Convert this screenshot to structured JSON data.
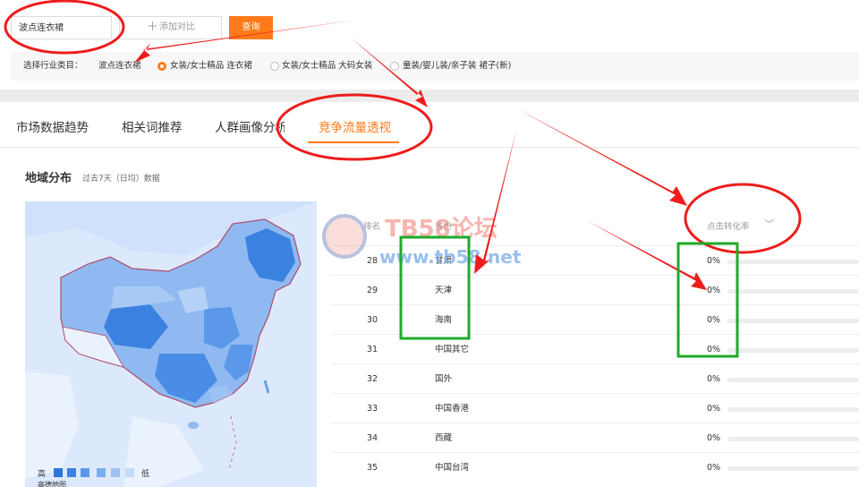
{
  "search": {
    "keyword": "波点连衣裙",
    "compare_label": "添加对比",
    "query_button": "查询"
  },
  "category": {
    "label": "选择行业类目：",
    "keyword": "波点连衣裙",
    "options": [
      {
        "label": "女装/女士精品 连衣裙",
        "selected": true
      },
      {
        "label": "女装/女士精品 大码女装",
        "selected": false
      },
      {
        "label": "童装/婴儿装/亲子装 裙子(新)",
        "selected": false
      }
    ]
  },
  "tabs": [
    {
      "label": "市场数据趋势",
      "active": false
    },
    {
      "label": "相关词推荐",
      "active": false
    },
    {
      "label": "人群画像分析",
      "active": false
    },
    {
      "label": "竞争流量透视",
      "active": true
    }
  ],
  "region": {
    "title": "地域分布",
    "subtitle": "过去7天（日均）数据",
    "legend_high": "高",
    "legend_low": "低",
    "map_credit": "高德地图"
  },
  "table": {
    "col_rank": "排名",
    "col_province": "省份",
    "col_metric": "点击转化率",
    "rows": [
      {
        "rank": "28",
        "province": "甘肃",
        "value": "0%",
        "bar": 0
      },
      {
        "rank": "29",
        "province": "天津",
        "value": "0%",
        "bar": 0
      },
      {
        "rank": "30",
        "province": "海南",
        "value": "0%",
        "bar": 0
      },
      {
        "rank": "31",
        "province": "中国其它",
        "value": "0%",
        "bar": 0
      },
      {
        "rank": "32",
        "province": "国外",
        "value": "0%",
        "bar": 0
      },
      {
        "rank": "33",
        "province": "中国香港",
        "value": "0%",
        "bar": 0
      },
      {
        "rank": "34",
        "province": "西藏",
        "value": "0%",
        "bar": 0
      },
      {
        "rank": "35",
        "province": "中国台湾",
        "value": "0%",
        "bar": 0
      }
    ]
  },
  "watermark": {
    "title": "TB58论坛",
    "url": "www.tb58.net"
  },
  "colors": {
    "accent": "#ff7a1a",
    "annotation_red": "#ee1c1c",
    "annotation_green": "#1faa2a",
    "map_dark": "#3b82e0",
    "map_light": "#a9c9f5"
  }
}
